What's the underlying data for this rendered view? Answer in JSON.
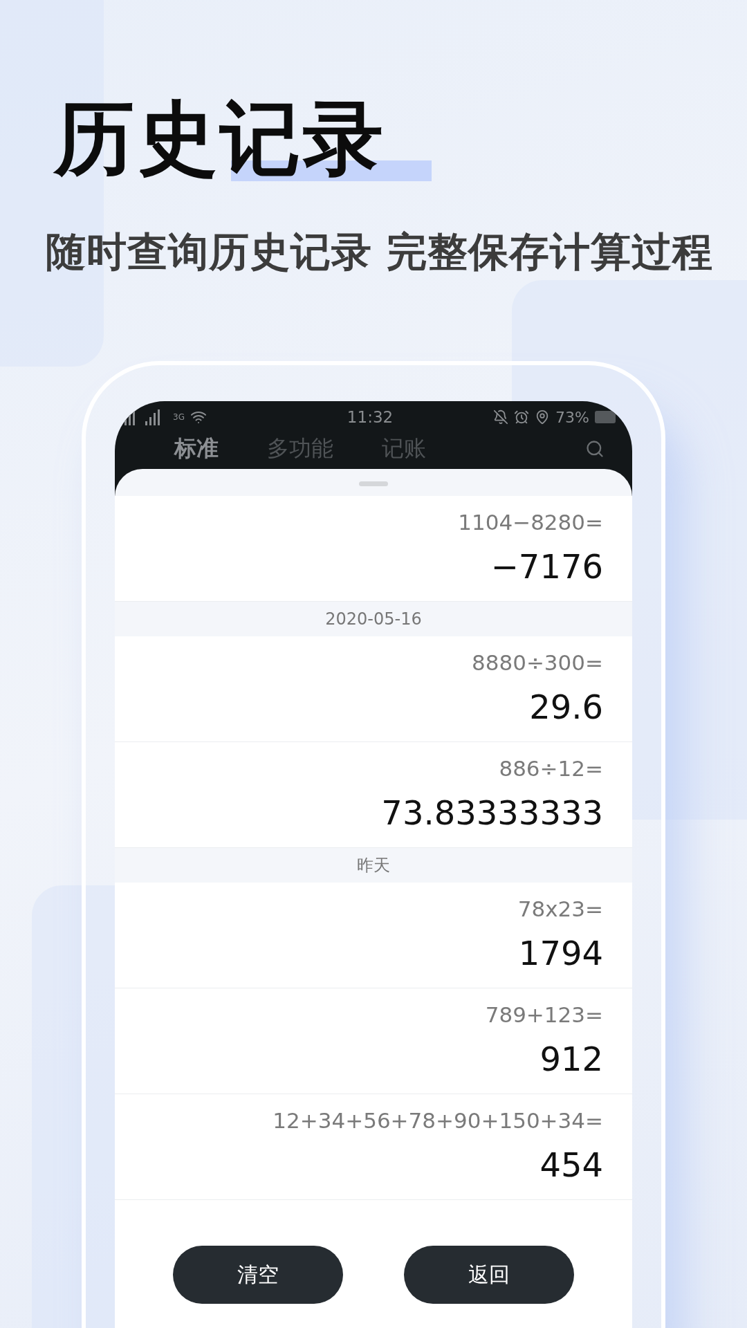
{
  "title": "历史记录",
  "subtitle": "随时查询历史记录 完整保存计算过程",
  "status_bar": {
    "network": "3G",
    "time": "11:32",
    "battery": "73%"
  },
  "tabs": [
    {
      "label": "标准",
      "selected": true
    },
    {
      "label": "多功能",
      "selected": false
    },
    {
      "label": "记账",
      "selected": false
    }
  ],
  "history": [
    {
      "kind": "entry",
      "expression": "1104−8280=",
      "result": "−7176"
    },
    {
      "kind": "date",
      "label": "2020-05-16"
    },
    {
      "kind": "entry",
      "expression": "8880÷300=",
      "result": "29.6"
    },
    {
      "kind": "entry",
      "expression": "886÷12=",
      "result": "73.83333333"
    },
    {
      "kind": "date",
      "label": "昨天"
    },
    {
      "kind": "entry",
      "expression": "78x23=",
      "result": "1794"
    },
    {
      "kind": "entry",
      "expression": "789+123=",
      "result": "912"
    },
    {
      "kind": "entry",
      "expression": "12+34+56+78+90+150+34=",
      "result": "454"
    }
  ],
  "buttons": [
    "清空",
    "返回"
  ]
}
